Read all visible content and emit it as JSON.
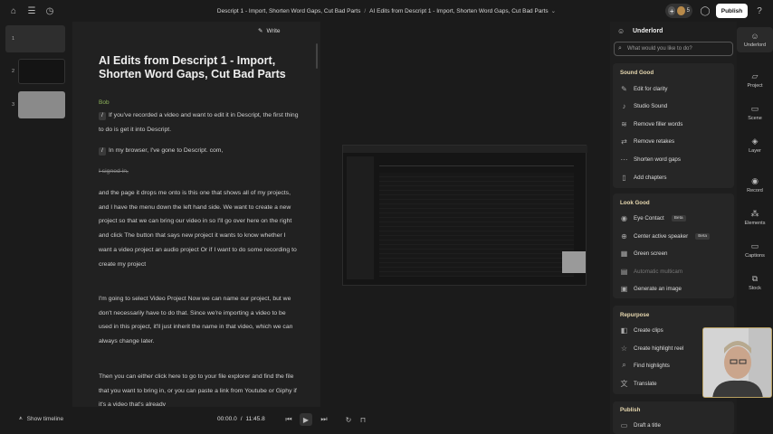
{
  "topbar": {
    "breadcrumb_project": "Descript 1 - Import, Shorten Word Gaps, Cut Bad Parts",
    "breadcrumb_separator": "/",
    "breadcrumb_composition": "AI Edits from Descript 1 - Import, Shorten Word Gaps, Cut Bad Parts",
    "collaborator_count": "5",
    "publish_label": "Publish"
  },
  "thumbnails": [
    {
      "number": "1"
    },
    {
      "number": "2"
    },
    {
      "number": "3"
    }
  ],
  "editor": {
    "write_label": "Write",
    "title": "AI Edits from Descript 1 - Import, Shorten Word Gaps, Cut Bad Parts",
    "speaker": "Bob",
    "paragraphs": [
      "If you've recorded a video and want to edit it in Descript, the first thing to do is get it into Descript.",
      "In my browser, I've gone to Descript. com,",
      "I signed in,",
      "and the page it drops me onto is this one that shows all of my projects, and I have the menu down the left hand side. We want to create a new project so that we can bring our video in so I'll go over here on the right and click The button that says new project it wants to know whether I want a video project an audio project Or if I want to do some recording to create my project",
      "I'm going to select Video Project Now we can name our project, but we don't necessarily have to do that. Since we're importing a video to be used in this project, it'll just inherit the name in that video, which we can always change later.",
      "Then you can either click here to go to your file explorer and find the file that you want to bring in, or you can paste a link from Youtube or Giphy if it's a video that's already"
    ]
  },
  "underlord": {
    "title": "Underlord",
    "search_placeholder": "What would you like to do?",
    "sections": [
      {
        "title": "Sound Good",
        "items": [
          "Edit for clarity",
          "Studio Sound",
          "Remove filler words",
          "Remove retakes",
          "Shorten word gaps",
          "Add chapters"
        ]
      },
      {
        "title": "Look Good",
        "items": [
          "Eye Contact",
          "Center active speaker",
          "Green screen",
          "Automatic multicam",
          "Generate an image"
        ],
        "beta_label": "Beta"
      },
      {
        "title": "Repurpose",
        "items": [
          "Create clips",
          "Create highlight reel",
          "Find highlights",
          "Translate"
        ]
      },
      {
        "title": "Publish",
        "items": [
          "Draft a title"
        ]
      }
    ]
  },
  "rail": [
    "Underlord",
    "Project",
    "Scene",
    "Layer",
    "Record",
    "Elements",
    "Captions",
    "Stock"
  ],
  "transport": {
    "current_time": "00:00.0",
    "separator": "/",
    "total_time": "11:45.8",
    "show_timeline_label": "Show timeline"
  },
  "colors": {
    "section_title": "#e8d9b0",
    "speaker": "#8fb45a",
    "webcam_border": "#b8a060"
  }
}
